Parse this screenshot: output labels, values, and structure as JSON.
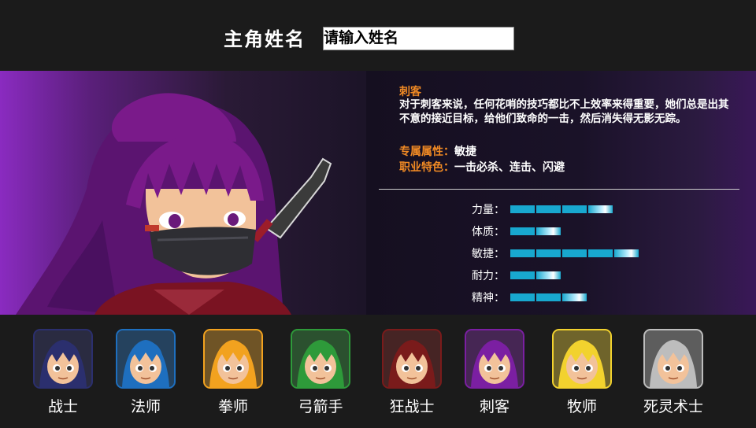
{
  "header": {
    "name_label": "主角姓名",
    "name_placeholder": "请输入姓名"
  },
  "selected_class": {
    "title": "刺客",
    "description": "对于刺客来说，任何花哨的技巧都比不上效率来得重要，她们总是出其不意的接近目标，给他们致命的一击，然后消失得无影无踪。",
    "attribute_key": "专属属性：",
    "attribute_value": "敏捷",
    "feature_key": "职业特色：",
    "feature_value": "一击必杀、连击、闪避"
  },
  "stats": [
    {
      "label": "力量：",
      "level": 4
    },
    {
      "label": "体质：",
      "level": 2
    },
    {
      "label": "敏捷：",
      "level": 5
    },
    {
      "label": "耐力：",
      "level": 2
    },
    {
      "label": "精神：",
      "level": 3
    }
  ],
  "roster": [
    {
      "name": "战士",
      "icon": "warrior-portrait-icon",
      "accent": "#2b2f6e"
    },
    {
      "name": "法师",
      "icon": "mage-portrait-icon",
      "accent": "#1e6fbf"
    },
    {
      "name": "拳师",
      "icon": "fighter-portrait-icon",
      "accent": "#f2a21f"
    },
    {
      "name": "弓箭手",
      "icon": "archer-portrait-icon",
      "accent": "#2e9a3a"
    },
    {
      "name": "狂战士",
      "icon": "berserker-portrait-icon",
      "accent": "#7a1b1b"
    },
    {
      "name": "刺客",
      "icon": "assassin-portrait-icon",
      "accent": "#7b1fa2"
    },
    {
      "name": "牧师",
      "icon": "priest-portrait-icon",
      "accent": "#f2d22e"
    },
    {
      "name": "死灵术士",
      "icon": "necromancer-portrait-icon",
      "accent": "#bdbdbd"
    }
  ],
  "colors": {
    "highlight": "#f08a24",
    "stat_bar": "#18a8cf",
    "assassin_hair": "#7a1a8a"
  }
}
